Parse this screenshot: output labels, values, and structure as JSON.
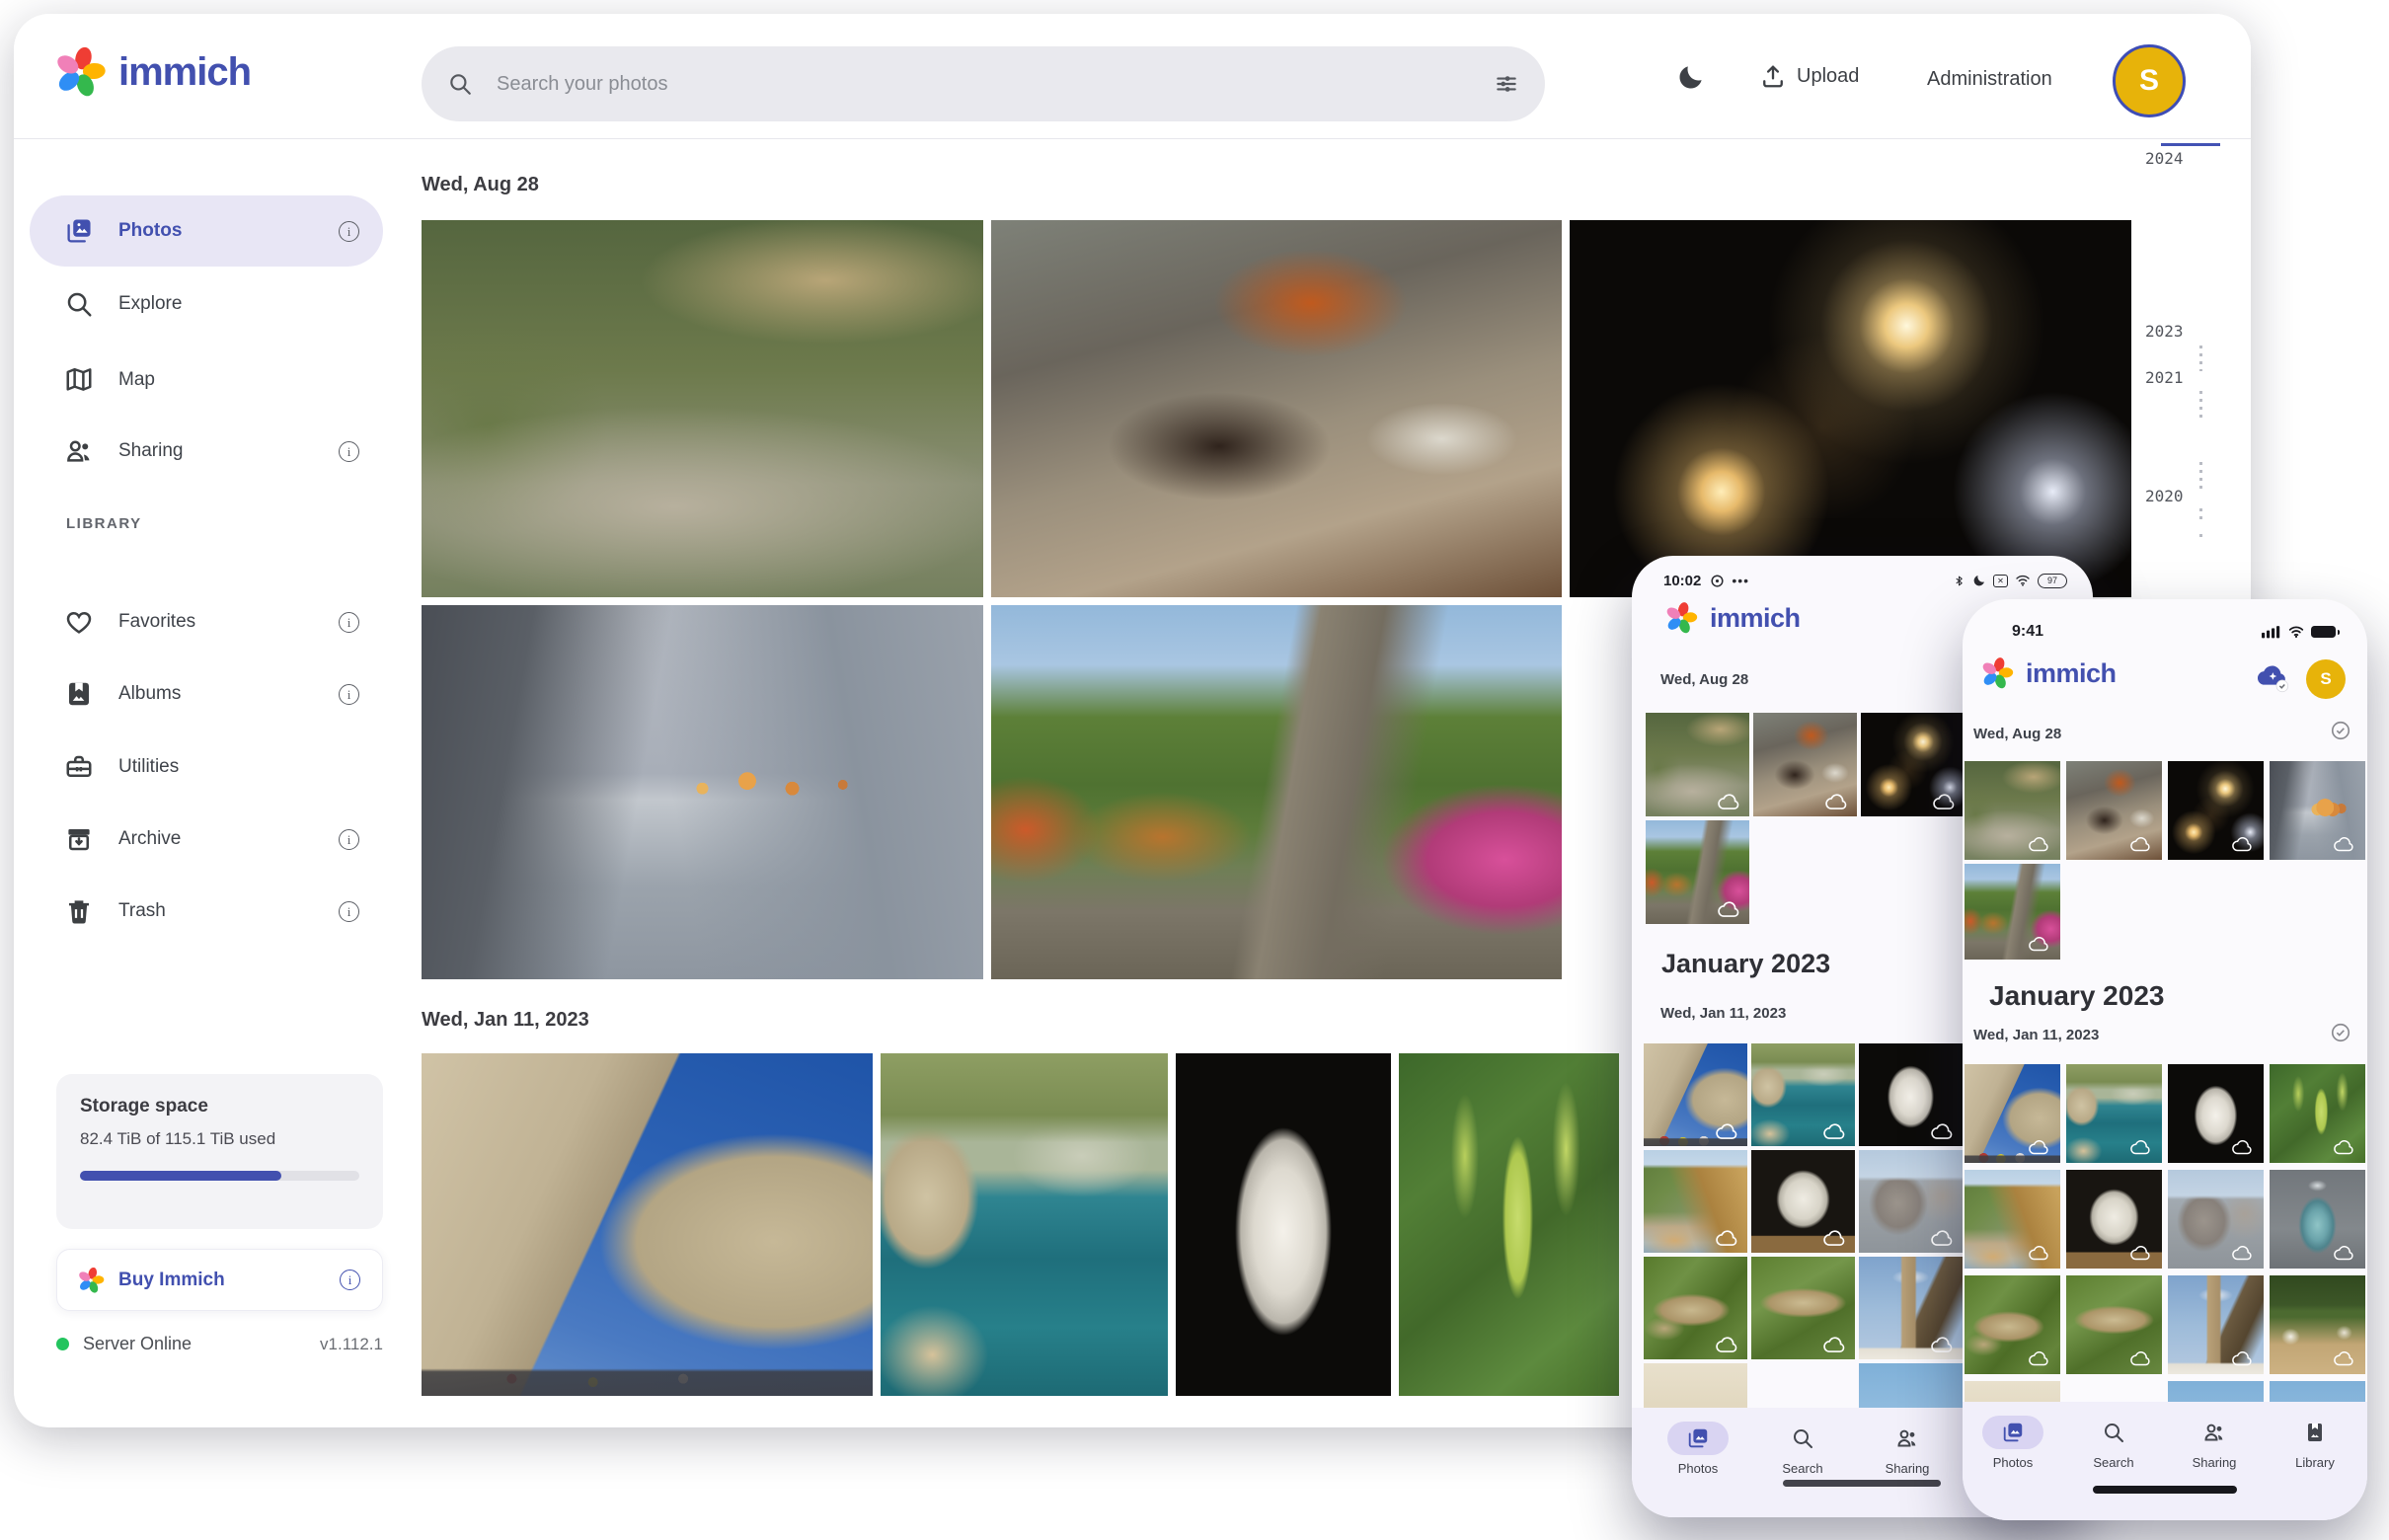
{
  "header": {
    "logo_text": "immich",
    "search_placeholder": "Search your photos",
    "upload_label": "Upload",
    "administration_label": "Administration",
    "avatar_initial": "S"
  },
  "sidebar": {
    "items": [
      {
        "label": "Photos",
        "active": true,
        "has_info": true
      },
      {
        "label": "Explore",
        "active": false,
        "has_info": false
      },
      {
        "label": "Map",
        "active": false,
        "has_info": false
      },
      {
        "label": "Sharing",
        "active": false,
        "has_info": true
      }
    ],
    "library_label": "LIBRARY",
    "library_items": [
      {
        "label": "Favorites",
        "has_info": true
      },
      {
        "label": "Albums",
        "has_info": true
      },
      {
        "label": "Utilities",
        "has_info": false
      },
      {
        "label": "Archive",
        "has_info": true
      },
      {
        "label": "Trash",
        "has_info": true
      }
    ],
    "storage": {
      "title": "Storage space",
      "usage": "82.4 TiB of 115.1 TiB used",
      "percent_used": 72
    },
    "buy_button_label": "Buy Immich",
    "server_status": "Server Online",
    "version": "v1.112.1"
  },
  "timeline": {
    "years": [
      "2024",
      "2023",
      "2021",
      "2020"
    ]
  },
  "main": {
    "section1_date": "Wed, Aug 28",
    "section2_date": "Wed, Jan 11, 2023"
  },
  "phone_android": {
    "status_time": "10:02",
    "battery_percent": "97",
    "status_icons": [
      "notification-circle",
      "more-dots",
      "bluetooth",
      "moon",
      "muted-box",
      "wifi",
      "battery"
    ],
    "logo_text": "immich",
    "section1_date": "Wed, Aug 28",
    "month_header": "January 2023",
    "section2_date": "Wed, Jan 11, 2023",
    "tabs": [
      {
        "label": "Photos",
        "active": true
      },
      {
        "label": "Search",
        "active": false
      },
      {
        "label": "Sharing",
        "active": false
      }
    ]
  },
  "phone_ios": {
    "status_time": "9:41",
    "status_icons": [
      "cellular-signal",
      "wifi",
      "battery"
    ],
    "logo_text": "immich",
    "avatar_initial": "S",
    "section1_date": "Wed, Aug 28",
    "month_header": "January 2023",
    "section2_date": "Wed, Jan 11, 2023",
    "tabs": [
      {
        "label": "Photos",
        "active": true
      },
      {
        "label": "Search",
        "active": false
      },
      {
        "label": "Sharing",
        "active": false
      },
      {
        "label": "Library",
        "active": false
      }
    ]
  },
  "colors": {
    "brand_indigo": "#4250af",
    "scrubber_marker_blue": "#4353b5",
    "avatar_gold": "#e7b30a",
    "server_online_green": "#23c45e",
    "sidebar_active_pill": "#e8e6f5",
    "search_bar_gray": "#e9e9ee"
  },
  "icons": {
    "logo": "flower-logo",
    "search": "magnifier",
    "search_filter": "sliders",
    "theme_toggle": "moon",
    "upload": "up-arrow-tray",
    "photos": "stacked-photos",
    "explore": "magnifier",
    "map": "trifold-map",
    "sharing": "people",
    "favorites": "heart",
    "albums": "photo-album",
    "utilities": "toolbox",
    "archive": "archive-box",
    "trash": "trash-can",
    "info": "circle-i",
    "server_status": "green-dot",
    "thumbnail_backup": "cloud-outline",
    "cloud_sync": "cloud-sparkle-check",
    "select_day": "check-circle",
    "library_tab": "book"
  }
}
